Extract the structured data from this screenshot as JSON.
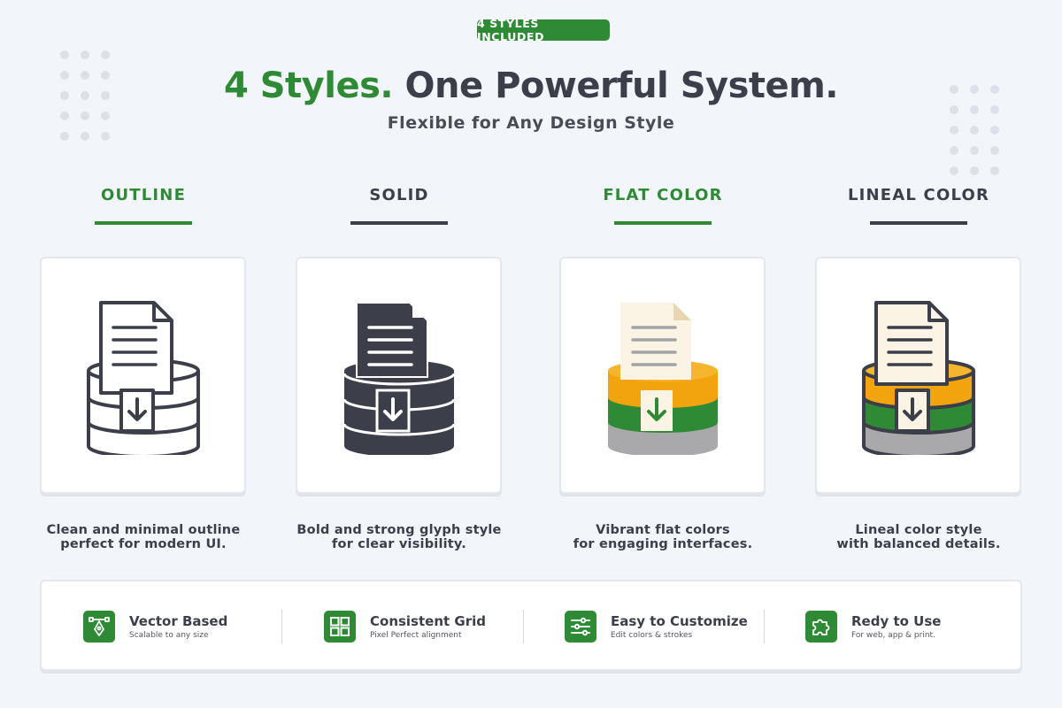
{
  "badge": "4 STYLES INCLUDED",
  "title": {
    "accent": "4 Styles.",
    "rest": "One Powerful System."
  },
  "subtitle": "Flexible for Any Design Style",
  "styles": [
    {
      "name": "OUTLINE",
      "desc1": "Clean and minimal outline",
      "desc2": "perfect for modern UI."
    },
    {
      "name": "SOLID",
      "desc1": "Bold and strong glyph style",
      "desc2": "for clear visibility."
    },
    {
      "name": "FLAT COLOR",
      "desc1": "Vibrant flat colors",
      "desc2": "for engaging interfaces."
    },
    {
      "name": "LINEAL COLOR",
      "desc1": "Lineal color style",
      "desc2": "with balanced details."
    }
  ],
  "features": [
    {
      "title": "Vector Based",
      "sub": "Scalable to any size",
      "icon": "pen-tool-icon"
    },
    {
      "title": "Consistent Grid",
      "sub": "Pixel Perfect alignment",
      "icon": "grid-icon"
    },
    {
      "title": "Easy to Customize",
      "sub": "Edit colors & strokes",
      "icon": "sliders-icon"
    },
    {
      "title": "Redy to Use",
      "sub": "For web, app & print.",
      "icon": "puzzle-icon"
    }
  ],
  "colors": {
    "accent": "#2f8a36",
    "dark": "#3c3e4a",
    "orange": "#f2a40e",
    "gray": "#a9a9ab",
    "paper": "#fbf4e4"
  }
}
